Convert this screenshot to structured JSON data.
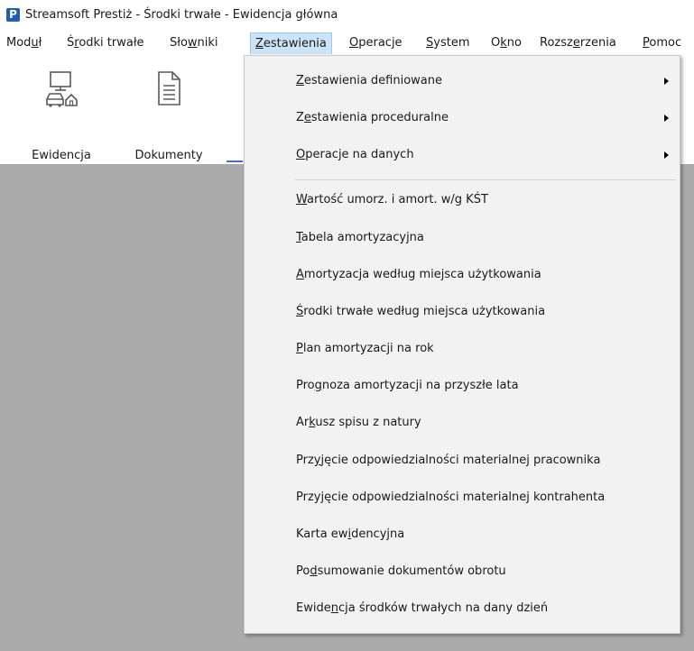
{
  "window": {
    "title": "Streamsoft Prestiż - Środki trwałe - Ewidencja główna",
    "logo": "P"
  },
  "menubar": {
    "items": [
      {
        "pre": "Mod",
        "u": "u",
        "post": "ł"
      },
      {
        "pre": "Ś",
        "u": "r",
        "post": "odki trwałe"
      },
      {
        "pre": "Sło",
        "u": "w",
        "post": "niki"
      },
      {
        "pre": "",
        "u": "Z",
        "post": "estawienia"
      },
      {
        "pre": "",
        "u": "O",
        "post": "peracje"
      },
      {
        "pre": "",
        "u": "S",
        "post": "ystem"
      },
      {
        "pre": "O",
        "u": "k",
        "post": "no"
      },
      {
        "pre": "Rozsz",
        "u": "e",
        "post": "rzenia"
      },
      {
        "pre": "",
        "u": "P",
        "post": "omoc"
      }
    ]
  },
  "toolbar": {
    "buttons": [
      {
        "label": "Ewidencja",
        "icon": "monitor-car-house-icon"
      },
      {
        "label": "Dokumenty",
        "icon": "document-icon"
      }
    ]
  },
  "dropdown": {
    "submenus": [
      {
        "pre": "",
        "u": "Z",
        "post": "estawienia definiowane"
      },
      {
        "pre": "Z",
        "u": "e",
        "post": "stawienia proceduralne"
      },
      {
        "pre": "",
        "u": "O",
        "post": "peracje na danych"
      }
    ],
    "items": [
      {
        "pre": "",
        "u": "W",
        "post": "artość umorz. i amort. w/g KŚT"
      },
      {
        "pre": "",
        "u": "T",
        "post": "abela amortyzacyjna"
      },
      {
        "pre": "",
        "u": "A",
        "post": "mortyzacja według miejsca użytkowania"
      },
      {
        "pre": "",
        "u": "Ś",
        "post": "rodki trwałe według miejsca użytkowania"
      },
      {
        "pre": "",
        "u": "P",
        "post": "lan amortyzacji na rok"
      },
      {
        "pre": "Pro",
        "u": "g",
        "post": "noza amortyzacji na przyszłe lata"
      },
      {
        "pre": "Ar",
        "u": "k",
        "post": "usz spisu z natury"
      },
      {
        "pre": "Prz",
        "u": "y",
        "post": "jęcie odpowiedzialności materialnej pracownika"
      },
      {
        "pre": "Przy",
        "u": "j",
        "post": "ęcie odpowiedzialności materialnej kontrahenta"
      },
      {
        "pre": "Karta ew",
        "u": "i",
        "post": "dencyjna"
      },
      {
        "pre": "Po",
        "u": "d",
        "post": "sumowanie dokumentów obrotu"
      },
      {
        "pre": "Ewide",
        "u": "n",
        "post": "cja środków trwałych na dany dzień"
      }
    ]
  }
}
